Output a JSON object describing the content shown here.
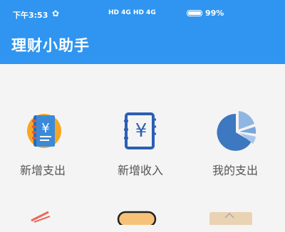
{
  "status_bar": {
    "time": "下午3:53",
    "signal_text": "HD 4G HD 4G",
    "battery": "99%"
  },
  "app": {
    "title": "理财小助手"
  },
  "grid": {
    "items": [
      {
        "label": "新增支出",
        "icon": "expense-book-icon"
      },
      {
        "label": "新增收入",
        "icon": "income-notebook-icon"
      },
      {
        "label": "我的支出",
        "icon": "pie-chart-icon"
      }
    ]
  },
  "colors": {
    "app_bar": "#2f95f0",
    "background": "#f4f4f4",
    "label_text": "#555555"
  }
}
